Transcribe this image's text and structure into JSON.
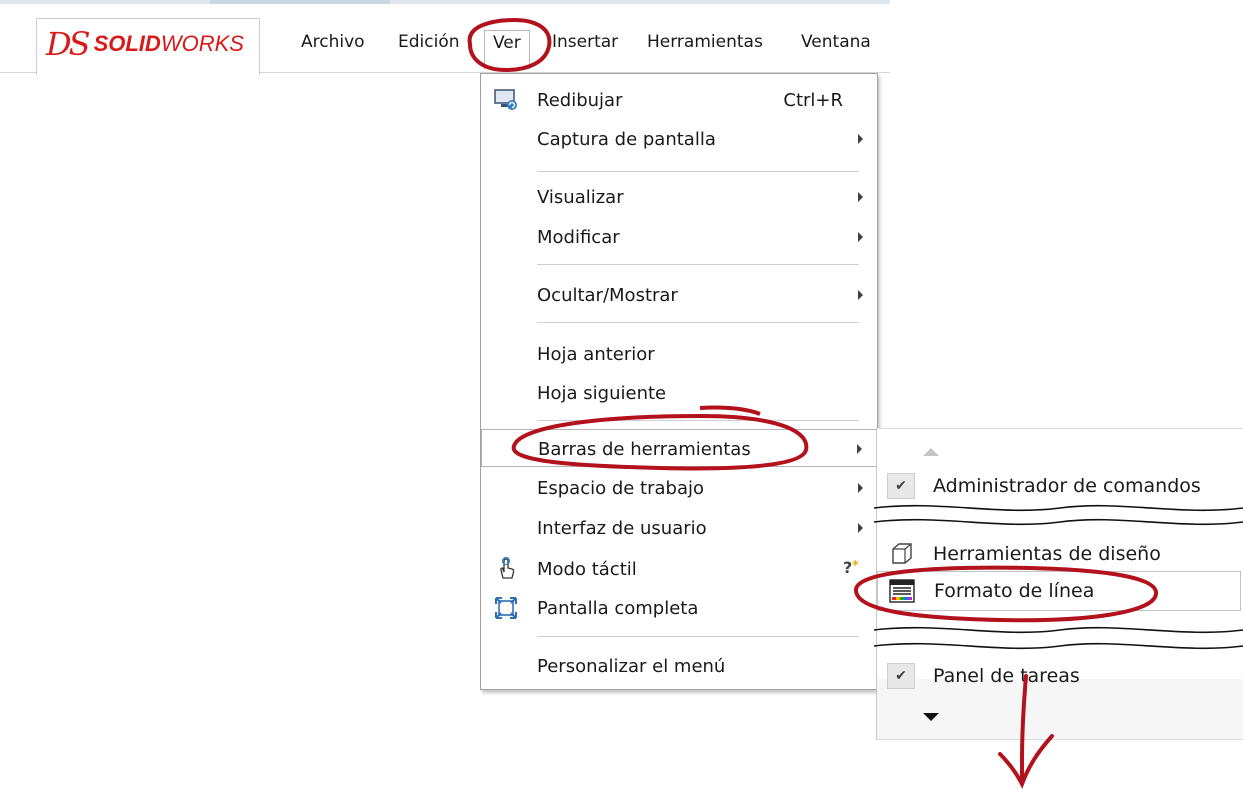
{
  "app": {
    "brand_ds": "DS",
    "brand_solid": "SOLID",
    "brand_works": "WORKS"
  },
  "menubar": {
    "items": [
      {
        "label": "Archivo"
      },
      {
        "label": "Edición"
      },
      {
        "label": "Ver"
      },
      {
        "label": "Insertar"
      },
      {
        "label": "Herramientas"
      },
      {
        "label": "Ventana"
      }
    ]
  },
  "view_menu": {
    "items": [
      {
        "label": "Redibujar",
        "shortcut": "Ctrl+R",
        "icon": "redraw-icon"
      },
      {
        "label": "Captura de pantalla",
        "submenu": true
      },
      {
        "label": "Visualizar",
        "submenu": true
      },
      {
        "label": "Modificar",
        "submenu": true
      },
      {
        "label": "Ocultar/Mostrar",
        "submenu": true
      },
      {
        "label": "Hoja anterior"
      },
      {
        "label": "Hoja siguiente"
      },
      {
        "label": "Barras de herramientas",
        "submenu": true,
        "highlighted": true
      },
      {
        "label": "Espacio de trabajo",
        "submenu": true
      },
      {
        "label": "Interfaz de usuario",
        "submenu": true
      },
      {
        "label": "Modo táctil",
        "icon": "touch-icon"
      },
      {
        "label": "Pantalla completa",
        "icon": "fullscreen-icon"
      },
      {
        "label": "Personalizar el menú"
      }
    ]
  },
  "toolbars_submenu": {
    "items": [
      {
        "label": "Administrador de comandos",
        "checked": true
      },
      {
        "label": "Herramientas de diseño",
        "icon": "sketch-tools-icon"
      },
      {
        "label": "Formato de línea",
        "icon": "line-format-icon",
        "highlighted": true
      },
      {
        "label": "Panel de tareas",
        "checked": true
      }
    ]
  },
  "colors": {
    "brand": "#d81a1a",
    "annotation": "#b3121c"
  }
}
